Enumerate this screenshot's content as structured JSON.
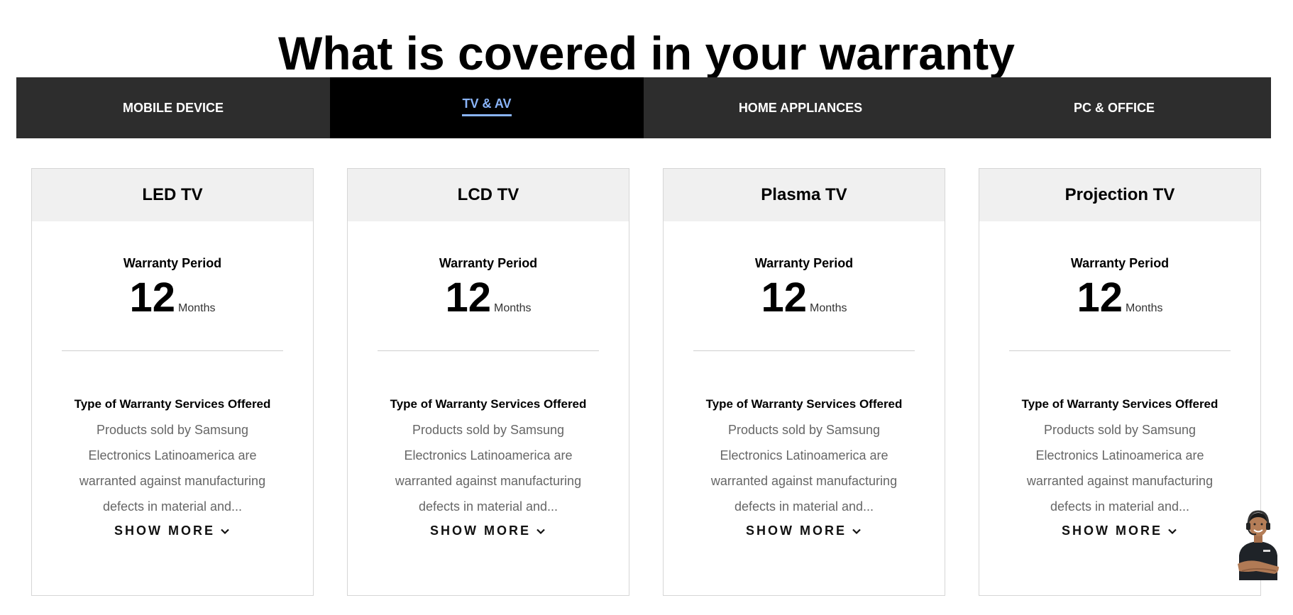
{
  "title": "What is covered in your warranty",
  "tabs": [
    {
      "label": "MOBILE DEVICE",
      "active": false
    },
    {
      "label": "TV & AV",
      "active": true
    },
    {
      "label": "HOME APPLIANCES",
      "active": false
    },
    {
      "label": "PC & OFFICE",
      "active": false
    }
  ],
  "colors": {
    "tab_bar": "#2d2d2d",
    "active_tab": "#000000",
    "active_accent": "#8ab4f8",
    "card_header": "#f0f0f0"
  },
  "cards": [
    {
      "name": "LED TV",
      "period_label": "Warranty Period",
      "period_value": "12",
      "period_unit": "Months",
      "services_title": "Type of Warranty Services Offered",
      "services_text": "Products sold by Samsung Electronics Latinoamerica are warranted against manufacturing defects in material and...",
      "show_more": "SHOW MORE",
      "show_more_icon": "chevron-down-icon"
    },
    {
      "name": "LCD TV",
      "period_label": "Warranty Period",
      "period_value": "12",
      "period_unit": "Months",
      "services_title": "Type of Warranty Services Offered",
      "services_text": "Products sold by Samsung Electronics Latinoamerica are warranted against manufacturing defects in material and...",
      "show_more": "SHOW MORE",
      "show_more_icon": "chevron-down-icon"
    },
    {
      "name": "Plasma TV",
      "period_label": "Warranty Period",
      "period_value": "12",
      "period_unit": "Months",
      "services_title": "Type of Warranty Services Offered",
      "services_text": "Products sold by Samsung Electronics Latinoamerica are warranted against manufacturing defects in material and...",
      "show_more": "SHOW MORE",
      "show_more_icon": "chevron-down-icon"
    },
    {
      "name": "Projection TV",
      "period_label": "Warranty Period",
      "period_value": "12",
      "period_unit": "Months",
      "services_title": "Type of Warranty Services Offered",
      "services_text": "Products sold by Samsung Electronics Latinoamerica are warranted against manufacturing defects in material and...",
      "show_more": "SHOW MORE",
      "show_more_icon": "chevron-down-icon"
    }
  ],
  "assistant_icon": "chat-assistant-avatar-icon"
}
